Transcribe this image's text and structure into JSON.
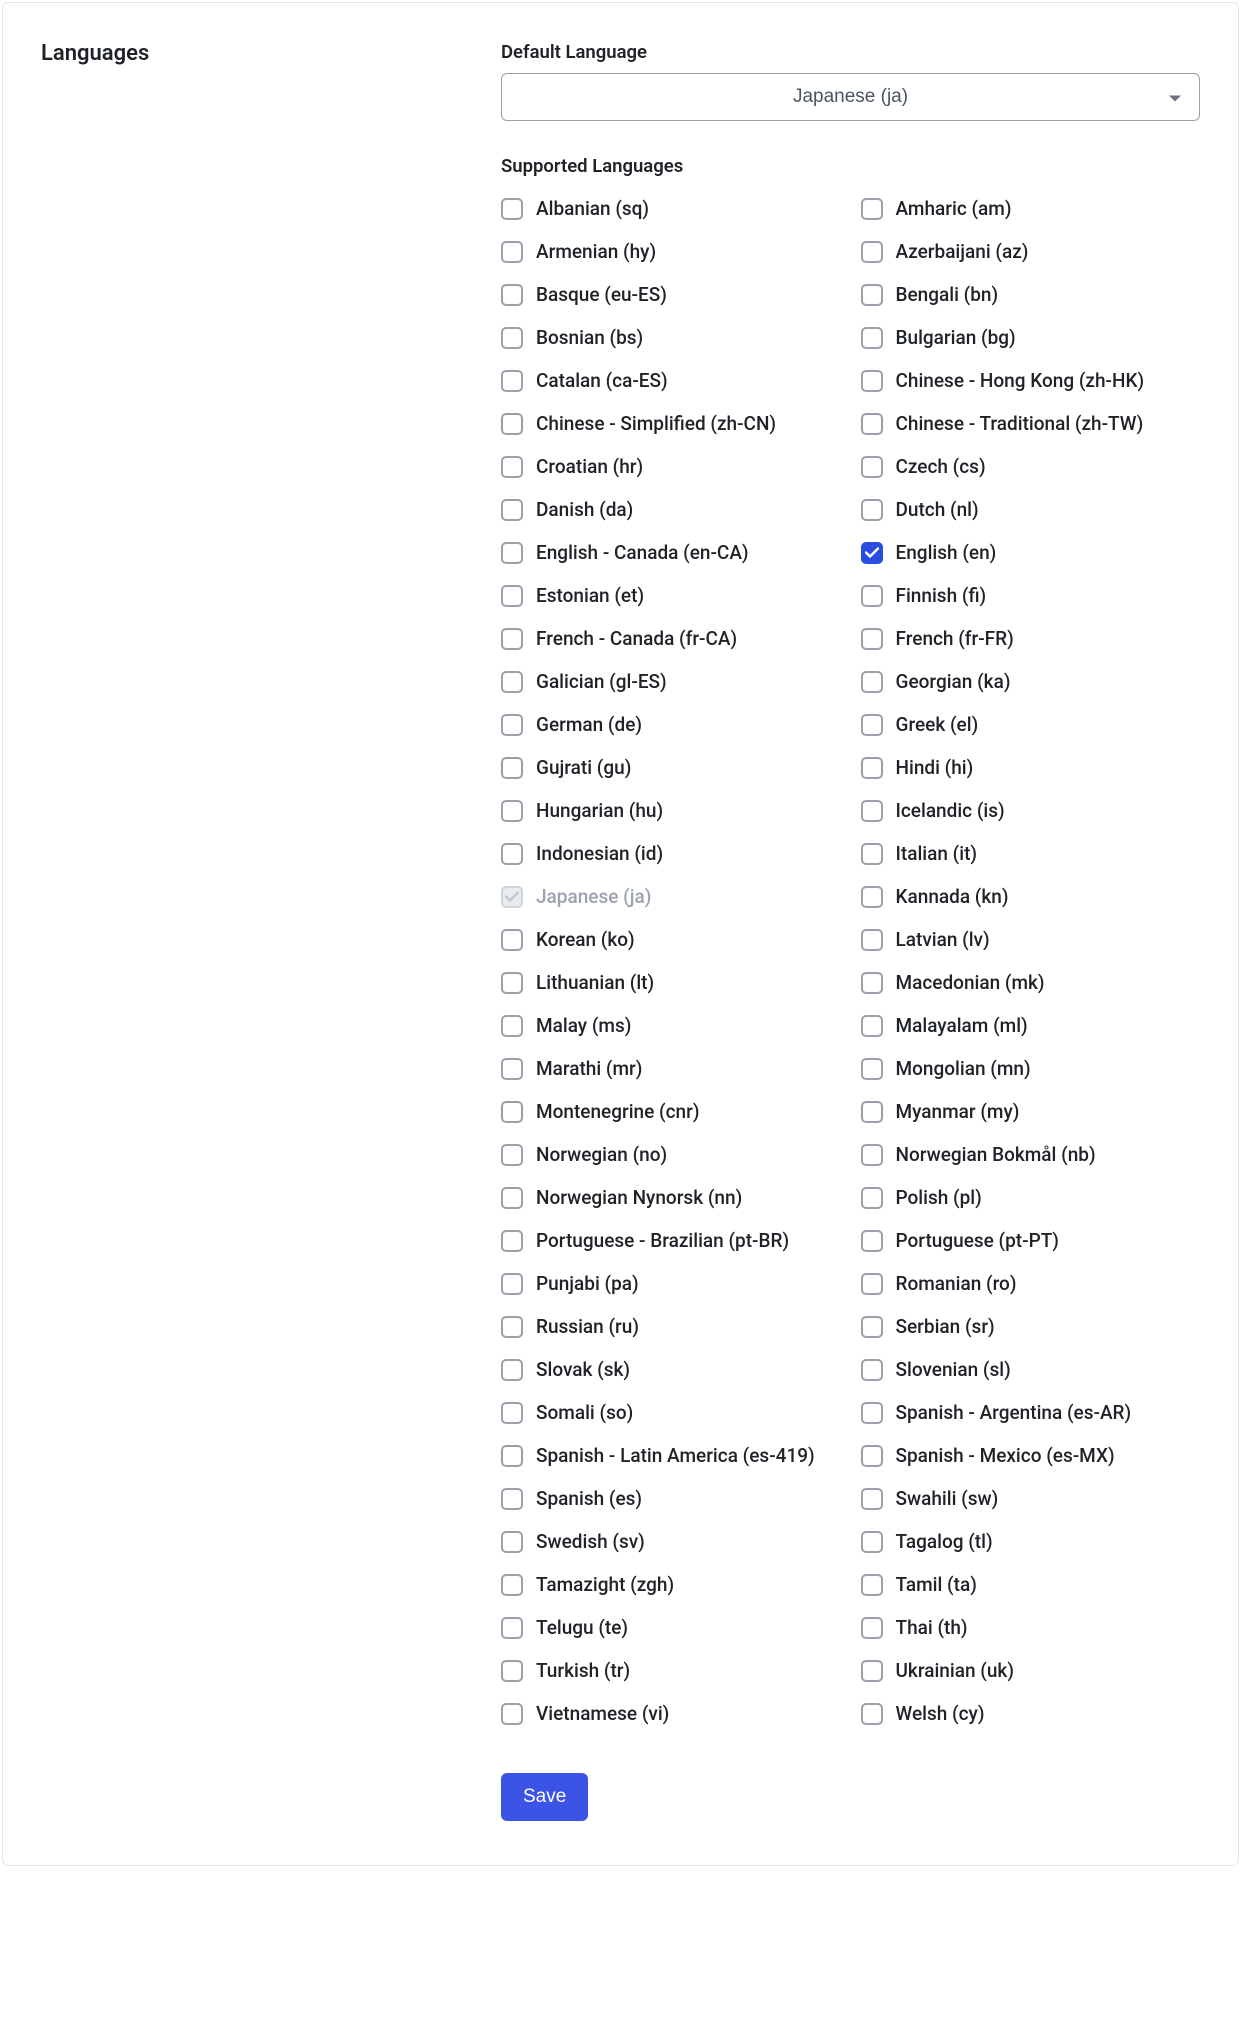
{
  "section_title": "Languages",
  "default_language": {
    "label": "Default Language",
    "selected": "Japanese (ja)"
  },
  "supported_languages_label": "Supported Languages",
  "languages": [
    {
      "label": "Albanian (sq)",
      "checked": false,
      "disabled": false
    },
    {
      "label": "Amharic (am)",
      "checked": false,
      "disabled": false
    },
    {
      "label": "Armenian (hy)",
      "checked": false,
      "disabled": false
    },
    {
      "label": "Azerbaijani (az)",
      "checked": false,
      "disabled": false
    },
    {
      "label": "Basque (eu-ES)",
      "checked": false,
      "disabled": false
    },
    {
      "label": "Bengali (bn)",
      "checked": false,
      "disabled": false
    },
    {
      "label": "Bosnian (bs)",
      "checked": false,
      "disabled": false
    },
    {
      "label": "Bulgarian (bg)",
      "checked": false,
      "disabled": false
    },
    {
      "label": "Catalan (ca-ES)",
      "checked": false,
      "disabled": false
    },
    {
      "label": "Chinese - Hong Kong (zh-HK)",
      "checked": false,
      "disabled": false
    },
    {
      "label": "Chinese - Simplified (zh-CN)",
      "checked": false,
      "disabled": false
    },
    {
      "label": "Chinese - Traditional (zh-TW)",
      "checked": false,
      "disabled": false
    },
    {
      "label": "Croatian (hr)",
      "checked": false,
      "disabled": false
    },
    {
      "label": "Czech (cs)",
      "checked": false,
      "disabled": false
    },
    {
      "label": "Danish (da)",
      "checked": false,
      "disabled": false
    },
    {
      "label": "Dutch (nl)",
      "checked": false,
      "disabled": false
    },
    {
      "label": "English - Canada (en-CA)",
      "checked": false,
      "disabled": false
    },
    {
      "label": "English (en)",
      "checked": true,
      "disabled": false
    },
    {
      "label": "Estonian (et)",
      "checked": false,
      "disabled": false
    },
    {
      "label": "Finnish (fi)",
      "checked": false,
      "disabled": false
    },
    {
      "label": "French - Canada (fr-CA)",
      "checked": false,
      "disabled": false
    },
    {
      "label": "French (fr-FR)",
      "checked": false,
      "disabled": false
    },
    {
      "label": "Galician (gl-ES)",
      "checked": false,
      "disabled": false
    },
    {
      "label": "Georgian (ka)",
      "checked": false,
      "disabled": false
    },
    {
      "label": "German (de)",
      "checked": false,
      "disabled": false
    },
    {
      "label": "Greek (el)",
      "checked": false,
      "disabled": false
    },
    {
      "label": "Gujrati (gu)",
      "checked": false,
      "disabled": false
    },
    {
      "label": "Hindi (hi)",
      "checked": false,
      "disabled": false
    },
    {
      "label": "Hungarian (hu)",
      "checked": false,
      "disabled": false
    },
    {
      "label": "Icelandic (is)",
      "checked": false,
      "disabled": false
    },
    {
      "label": "Indonesian (id)",
      "checked": false,
      "disabled": false
    },
    {
      "label": "Italian (it)",
      "checked": false,
      "disabled": false
    },
    {
      "label": "Japanese (ja)",
      "checked": true,
      "disabled": true
    },
    {
      "label": "Kannada (kn)",
      "checked": false,
      "disabled": false
    },
    {
      "label": "Korean (ko)",
      "checked": false,
      "disabled": false
    },
    {
      "label": "Latvian (lv)",
      "checked": false,
      "disabled": false
    },
    {
      "label": "Lithuanian (lt)",
      "checked": false,
      "disabled": false
    },
    {
      "label": "Macedonian (mk)",
      "checked": false,
      "disabled": false
    },
    {
      "label": "Malay (ms)",
      "checked": false,
      "disabled": false
    },
    {
      "label": "Malayalam (ml)",
      "checked": false,
      "disabled": false
    },
    {
      "label": "Marathi (mr)",
      "checked": false,
      "disabled": false
    },
    {
      "label": "Mongolian (mn)",
      "checked": false,
      "disabled": false
    },
    {
      "label": "Montenegrine (cnr)",
      "checked": false,
      "disabled": false
    },
    {
      "label": "Myanmar (my)",
      "checked": false,
      "disabled": false
    },
    {
      "label": "Norwegian (no)",
      "checked": false,
      "disabled": false
    },
    {
      "label": "Norwegian Bokmål (nb)",
      "checked": false,
      "disabled": false
    },
    {
      "label": "Norwegian Nynorsk (nn)",
      "checked": false,
      "disabled": false
    },
    {
      "label": "Polish (pl)",
      "checked": false,
      "disabled": false
    },
    {
      "label": "Portuguese - Brazilian (pt-BR)",
      "checked": false,
      "disabled": false
    },
    {
      "label": "Portuguese (pt-PT)",
      "checked": false,
      "disabled": false
    },
    {
      "label": "Punjabi (pa)",
      "checked": false,
      "disabled": false
    },
    {
      "label": "Romanian (ro)",
      "checked": false,
      "disabled": false
    },
    {
      "label": "Russian (ru)",
      "checked": false,
      "disabled": false
    },
    {
      "label": "Serbian (sr)",
      "checked": false,
      "disabled": false
    },
    {
      "label": "Slovak (sk)",
      "checked": false,
      "disabled": false
    },
    {
      "label": "Slovenian (sl)",
      "checked": false,
      "disabled": false
    },
    {
      "label": "Somali (so)",
      "checked": false,
      "disabled": false
    },
    {
      "label": "Spanish - Argentina (es-AR)",
      "checked": false,
      "disabled": false
    },
    {
      "label": "Spanish - Latin America (es-419)",
      "checked": false,
      "disabled": false
    },
    {
      "label": "Spanish - Mexico (es-MX)",
      "checked": false,
      "disabled": false
    },
    {
      "label": "Spanish (es)",
      "checked": false,
      "disabled": false
    },
    {
      "label": "Swahili (sw)",
      "checked": false,
      "disabled": false
    },
    {
      "label": "Swedish (sv)",
      "checked": false,
      "disabled": false
    },
    {
      "label": "Tagalog (tl)",
      "checked": false,
      "disabled": false
    },
    {
      "label": "Tamazight (zgh)",
      "checked": false,
      "disabled": false
    },
    {
      "label": "Tamil (ta)",
      "checked": false,
      "disabled": false
    },
    {
      "label": "Telugu (te)",
      "checked": false,
      "disabled": false
    },
    {
      "label": "Thai (th)",
      "checked": false,
      "disabled": false
    },
    {
      "label": "Turkish (tr)",
      "checked": false,
      "disabled": false
    },
    {
      "label": "Ukrainian (uk)",
      "checked": false,
      "disabled": false
    },
    {
      "label": "Vietnamese (vi)",
      "checked": false,
      "disabled": false
    },
    {
      "label": "Welsh (cy)",
      "checked": false,
      "disabled": false
    }
  ],
  "save_label": "Save"
}
